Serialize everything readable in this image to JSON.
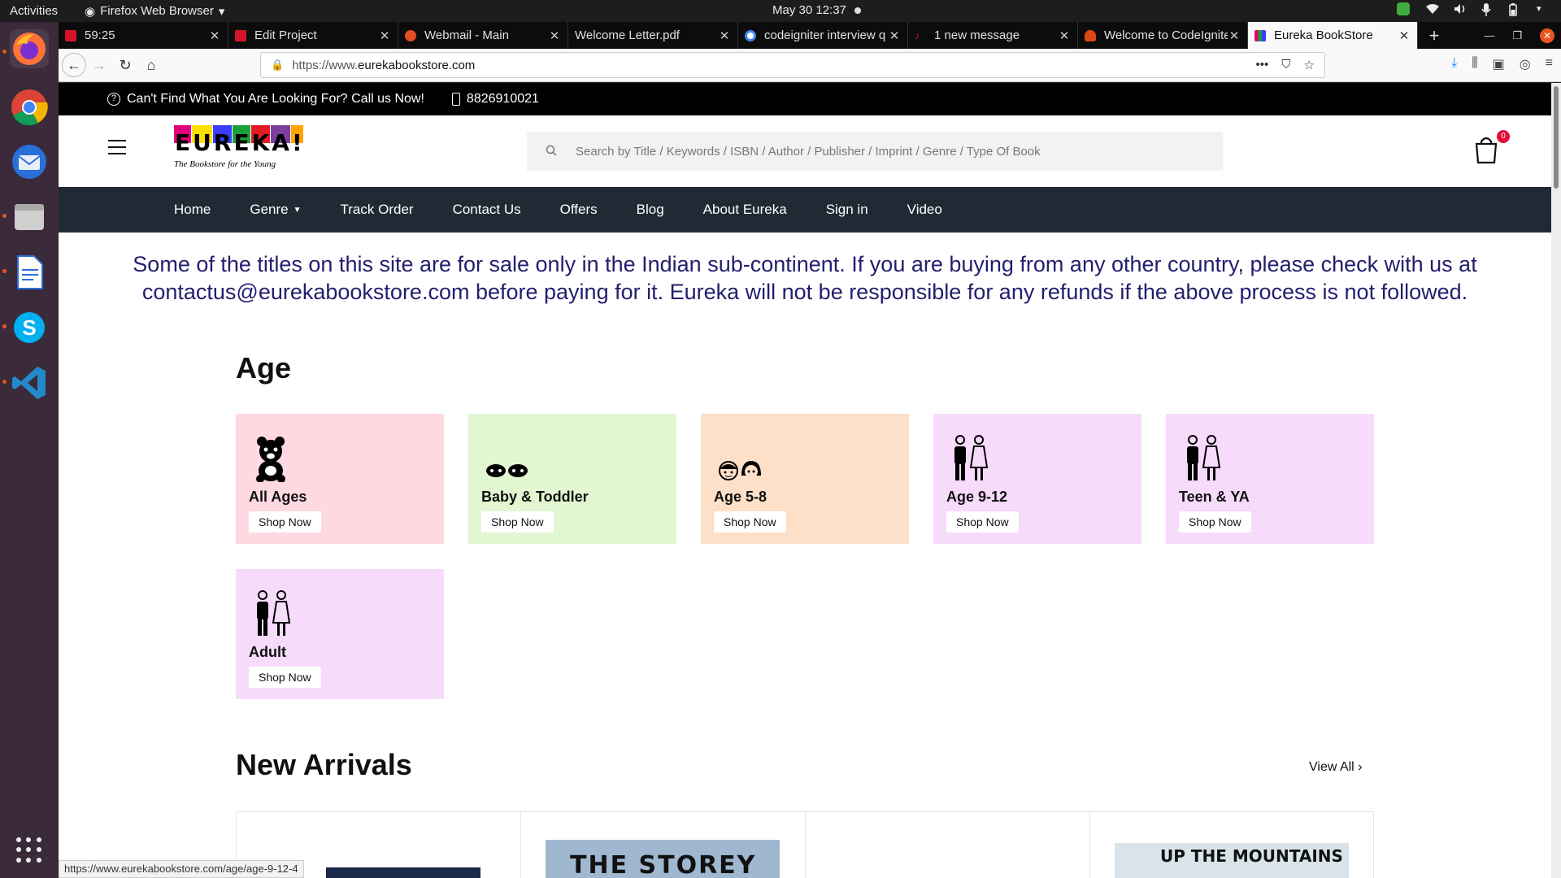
{
  "os": {
    "activities": "Activities",
    "app_name": "Firefox Web Browser",
    "datetime": "May 30  12:37"
  },
  "tabs": [
    {
      "title": "59:25",
      "favicon_color": "#d5142b"
    },
    {
      "title": "Edit Project",
      "favicon_color": "#d5142b"
    },
    {
      "title": "Webmail - Main",
      "favicon_color": "#e44d26"
    },
    {
      "title": "Welcome Letter.pdf",
      "favicon_color": "#777777"
    },
    {
      "title": "codeigniter interview q",
      "favicon_color": "#4285f4"
    },
    {
      "title": "1 new message",
      "favicon_color": "#d5142b"
    },
    {
      "title": "Welcome to CodeIgnite",
      "favicon_color": "#dd4814"
    },
    {
      "title": "Eureka BookStore",
      "favicon_color": "#2a7a2a"
    }
  ],
  "browser": {
    "url_prefix": "https://www.",
    "url_domain": "eurekabookstore.com",
    "status_url": "https://www.eurekabookstore.com/age/age-9-12-4"
  },
  "site": {
    "promo_question": "Can't Find What You Are Looking For? Call us Now!",
    "phone": "8826910021",
    "logo_letters": [
      "E",
      "U",
      "R",
      "E",
      "K",
      "A",
      "!"
    ],
    "logo_colors": [
      "#e3007d",
      "#ffe100",
      "#3c3cff",
      "#19a23a",
      "#e31b23",
      "#7b3fa0",
      "#ffa500"
    ],
    "logo_tagline": "The Bookstore for the Young",
    "search_placeholder": "Search by Title / Keywords / ISBN / Author / Publisher / Imprint / Genre / Type Of Book",
    "cart_count": "0",
    "nav": [
      "Home",
      "Genre",
      "Track Order",
      "Contact Us",
      "Offers",
      "Blog",
      "About Eureka",
      "Sign in",
      "Video"
    ],
    "notice": "Some of the titles on this site are for sale only in the Indian sub-continent. If you are buying from any other country, please check with us at contactus@eurekabookstore.com before paying for it. Eureka will not be responsible for any refunds if the above process is not followed.",
    "age_title": "Age",
    "age_cards": [
      {
        "label": "All Ages",
        "button": "Shop Now",
        "bg": "#ffd9e1",
        "icon": "teddy-bear-icon"
      },
      {
        "label": "Baby & Toddler",
        "button": "Shop Now",
        "bg": "#e2f6d2",
        "icon": "baby-faces-icon"
      },
      {
        "label": "Age 5-8",
        "button": "Shop Now",
        "bg": "#fde0c7",
        "icon": "kids-faces-icon"
      },
      {
        "label": "Age 9-12",
        "button": "Shop Now",
        "bg": "#f6dbfa",
        "icon": "boy-girl-icon"
      },
      {
        "label": "Teen & YA",
        "button": "Shop Now",
        "bg": "#f6dbfa",
        "icon": "boy-girl-icon"
      },
      {
        "label": "Adult",
        "button": "Shop Now",
        "bg": "#f6dbfa",
        "icon": "boy-girl-icon"
      }
    ],
    "new_arrivals_title": "New Arrivals",
    "view_all": "View All",
    "product_covers": [
      {
        "text": "",
        "color": "#1c2a4a"
      },
      {
        "text": "THE STOREY",
        "color": "#9fb8cf"
      },
      {
        "text": "",
        "color": "#ffffff"
      },
      {
        "text": "UP THE MOUNTAINS",
        "color": "#d8e4ea"
      }
    ]
  }
}
